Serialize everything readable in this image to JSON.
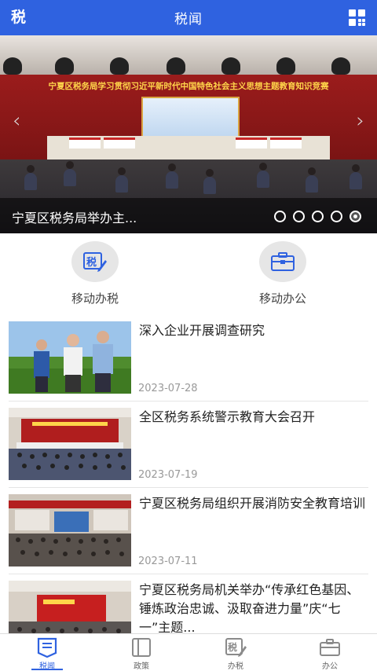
{
  "header": {
    "logo_text": "税",
    "title": "税闻",
    "menu_icon": "grid-menu-icon"
  },
  "banner": {
    "scene_text": "宁夏区税务局学习贯彻习近平新时代中国特色社会主义思想主题教育知识竞赛",
    "caption": "宁夏区税务局举办主...",
    "slide_count": 5,
    "active_slide": 5
  },
  "quick_entries": [
    {
      "label": "移动办税",
      "icon": "tax-edit-icon"
    },
    {
      "label": "移动办公",
      "icon": "briefcase-icon"
    }
  ],
  "news": [
    {
      "title": "深入企业开展调查研究",
      "date": "2023-07-28",
      "thumb": "field-visit-photo"
    },
    {
      "title": "全区税务系统警示教育大会召开",
      "date": "2023-07-19",
      "thumb": "meeting-hall-photo"
    },
    {
      "title": "宁夏区税务局组织开展消防安全教育培训",
      "date": "2023-07-11",
      "thumb": "training-room-photo"
    },
    {
      "title": "宁夏区税务局机关举办“传承红色基因、锤炼政治忠诚、汲取奋进力量”庆“七一”主题...",
      "date": "",
      "thumb": "stage-event-photo"
    }
  ],
  "tabbar": [
    {
      "label": "税闻",
      "icon": "news-icon",
      "active": true
    },
    {
      "label": "政策",
      "icon": "policy-icon",
      "active": false
    },
    {
      "label": "办税",
      "icon": "tax-service-icon",
      "active": false
    },
    {
      "label": "办公",
      "icon": "office-icon",
      "active": false
    }
  ],
  "colors": {
    "primary": "#2f62e0",
    "banner_red": "#9b1c1c",
    "banner_text_yellow": "#ffd54a",
    "date_gray": "#999999"
  }
}
